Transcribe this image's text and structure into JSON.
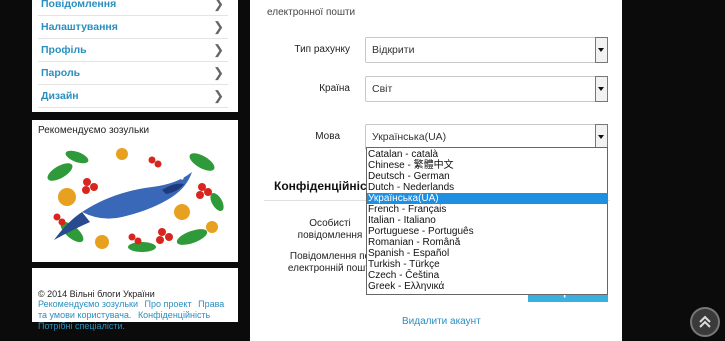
{
  "sidebar": {
    "nav_items": [
      {
        "label": "Повідомлення",
        "icon": "chevron-right-icon"
      },
      {
        "label": "Налаштування",
        "icon": "chevron-right-icon"
      },
      {
        "label": "Профіль",
        "icon": "chevron-right-icon"
      },
      {
        "label": "Пароль",
        "icon": "chevron-right-icon"
      },
      {
        "label": "Дизайн",
        "icon": "chevron-right-icon"
      }
    ],
    "recommend_title": "Рекомендуємо зозульки",
    "footer": {
      "copyright": "© 2014 Вільні блоги України",
      "links": [
        "Рекомендуємо зозульки",
        "Про проект",
        "Права та умови користувача.",
        "Конфіденційність",
        "Потрібні спеціалісти."
      ]
    }
  },
  "form": {
    "email_hint": "електронної пошти",
    "account_type": {
      "label": "Тип рахунку",
      "value": "Відкрити"
    },
    "country": {
      "label": "Країна",
      "value": "Світ"
    },
    "language": {
      "label": "Мова",
      "value": "Українська(UA)"
    },
    "privacy_title": "Конфіденційність",
    "private_messages_label": "Особисті повідомлення",
    "email_notifications_label": "Повідомлення по електронній пошті",
    "save_label": "Зберегти",
    "delete_account_label": "Видалити акаунт"
  },
  "language_dropdown": {
    "options": [
      "Catalan - català",
      "Chinese - 繁體中文",
      "Deutsch - German",
      "Dutch - Nederlands",
      "Українська(UA)",
      "French - Français",
      "Italian - Italiano",
      "Portuguese - Português",
      "Romanian - Română",
      "Spanish - Español",
      "Turkish - Türkçe",
      "Czech - Čeština",
      "Greek - Ελληνικά"
    ],
    "selected": "Українська(UA)"
  },
  "colors": {
    "link": "#2a8fc0",
    "accent": "#3ab0e0",
    "selection": "#1e8fe1"
  },
  "scroll_top_icon": "double-chevron-up-icon"
}
